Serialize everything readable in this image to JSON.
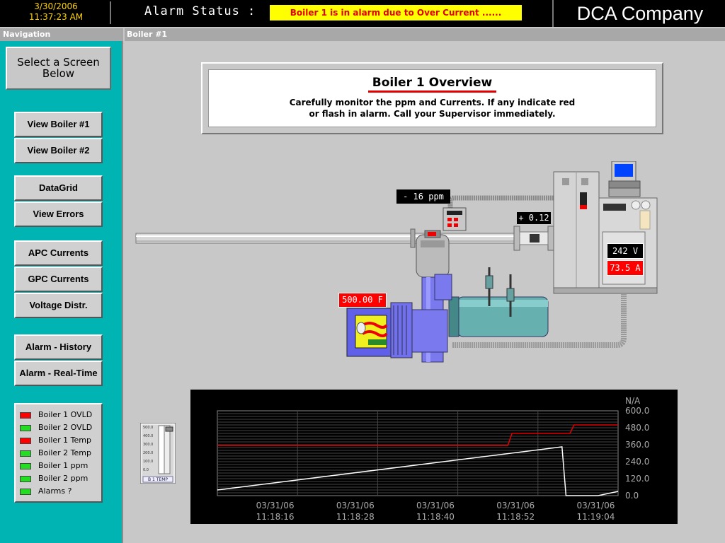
{
  "header": {
    "date": "3/30/2006",
    "time": "11:37:23 AM",
    "alarm_label": "Alarm Status :",
    "alarm_message": "Boiler 1 is in alarm due to Over Current ......",
    "company": "DCA Company"
  },
  "nav": {
    "title": "Navigation",
    "header_line1": "Select a Screen",
    "header_line2": "Below",
    "buttons": [
      "View Boiler #1",
      "View Boiler #2",
      "DataGrid",
      "View Errors",
      "APC Currents",
      "GPC Currents",
      "Voltage Distr.",
      "Alarm - History",
      "Alarm - Real-Time"
    ],
    "status": [
      {
        "label": "Boiler 1 OVLD",
        "state": "alarm"
      },
      {
        "label": "Boiler 2 OVLD",
        "state": "ok"
      },
      {
        "label": "Boiler 1 Temp",
        "state": "alarm"
      },
      {
        "label": "Boiler 2 Temp",
        "state": "ok"
      },
      {
        "label": "Boiler 1 ppm",
        "state": "ok"
      },
      {
        "label": "Boiler 2 ppm",
        "state": "ok"
      },
      {
        "label": "Alarms ?",
        "state": "ok"
      }
    ]
  },
  "main": {
    "panel_title": "Boiler #1",
    "overview_title": "Boiler 1 Overview",
    "overview_line1": "Carefully monitor the ppm and Currents.  If any indicate red",
    "overview_line2": "or flash in alarm. Call your Supervisor immediately."
  },
  "readouts": {
    "ppm": "- 16 ppm",
    "flow": "+ 0.12",
    "temp": "500.00 F",
    "voltage": "242 V",
    "current": "73.5 A"
  },
  "gauge": {
    "label": "B 1 TEMP",
    "ticks": [
      "500.0",
      "400.0",
      "300.0",
      "200.0",
      "100.0",
      "0.0"
    ]
  },
  "colors": {
    "alarm": "#ff0000",
    "ok": "#22dd22",
    "nav_bg": "#00b4b4",
    "alarm_bg": "#ffff00"
  },
  "chart_data": {
    "type": "line",
    "unit_label": "N/A",
    "ylim": [
      0,
      600
    ],
    "y_ticks": [
      "600.0",
      "480.0",
      "360.0",
      "240.0",
      "120.0",
      "0.0"
    ],
    "x_ticks": [
      {
        "date": "03/31/06",
        "time": "11:18:16"
      },
      {
        "date": "03/31/06",
        "time": "11:18:28"
      },
      {
        "date": "03/31/06",
        "time": "11:18:40"
      },
      {
        "date": "03/31/06",
        "time": "11:18:52"
      },
      {
        "date": "03/31/06",
        "time": "11:19:04"
      }
    ],
    "grid": true,
    "series": [
      {
        "color": "#e00000",
        "points": [
          [
            0,
            355
          ],
          [
            0.725,
            355
          ],
          [
            0.735,
            440
          ],
          [
            0.88,
            440
          ],
          [
            0.89,
            500
          ],
          [
            1,
            500
          ]
        ]
      },
      {
        "color": "#ffffff",
        "points": [
          [
            0,
            40
          ],
          [
            0.86,
            345
          ],
          [
            0.87,
            0
          ],
          [
            0.95,
            0
          ],
          [
            1,
            30
          ]
        ]
      }
    ]
  }
}
